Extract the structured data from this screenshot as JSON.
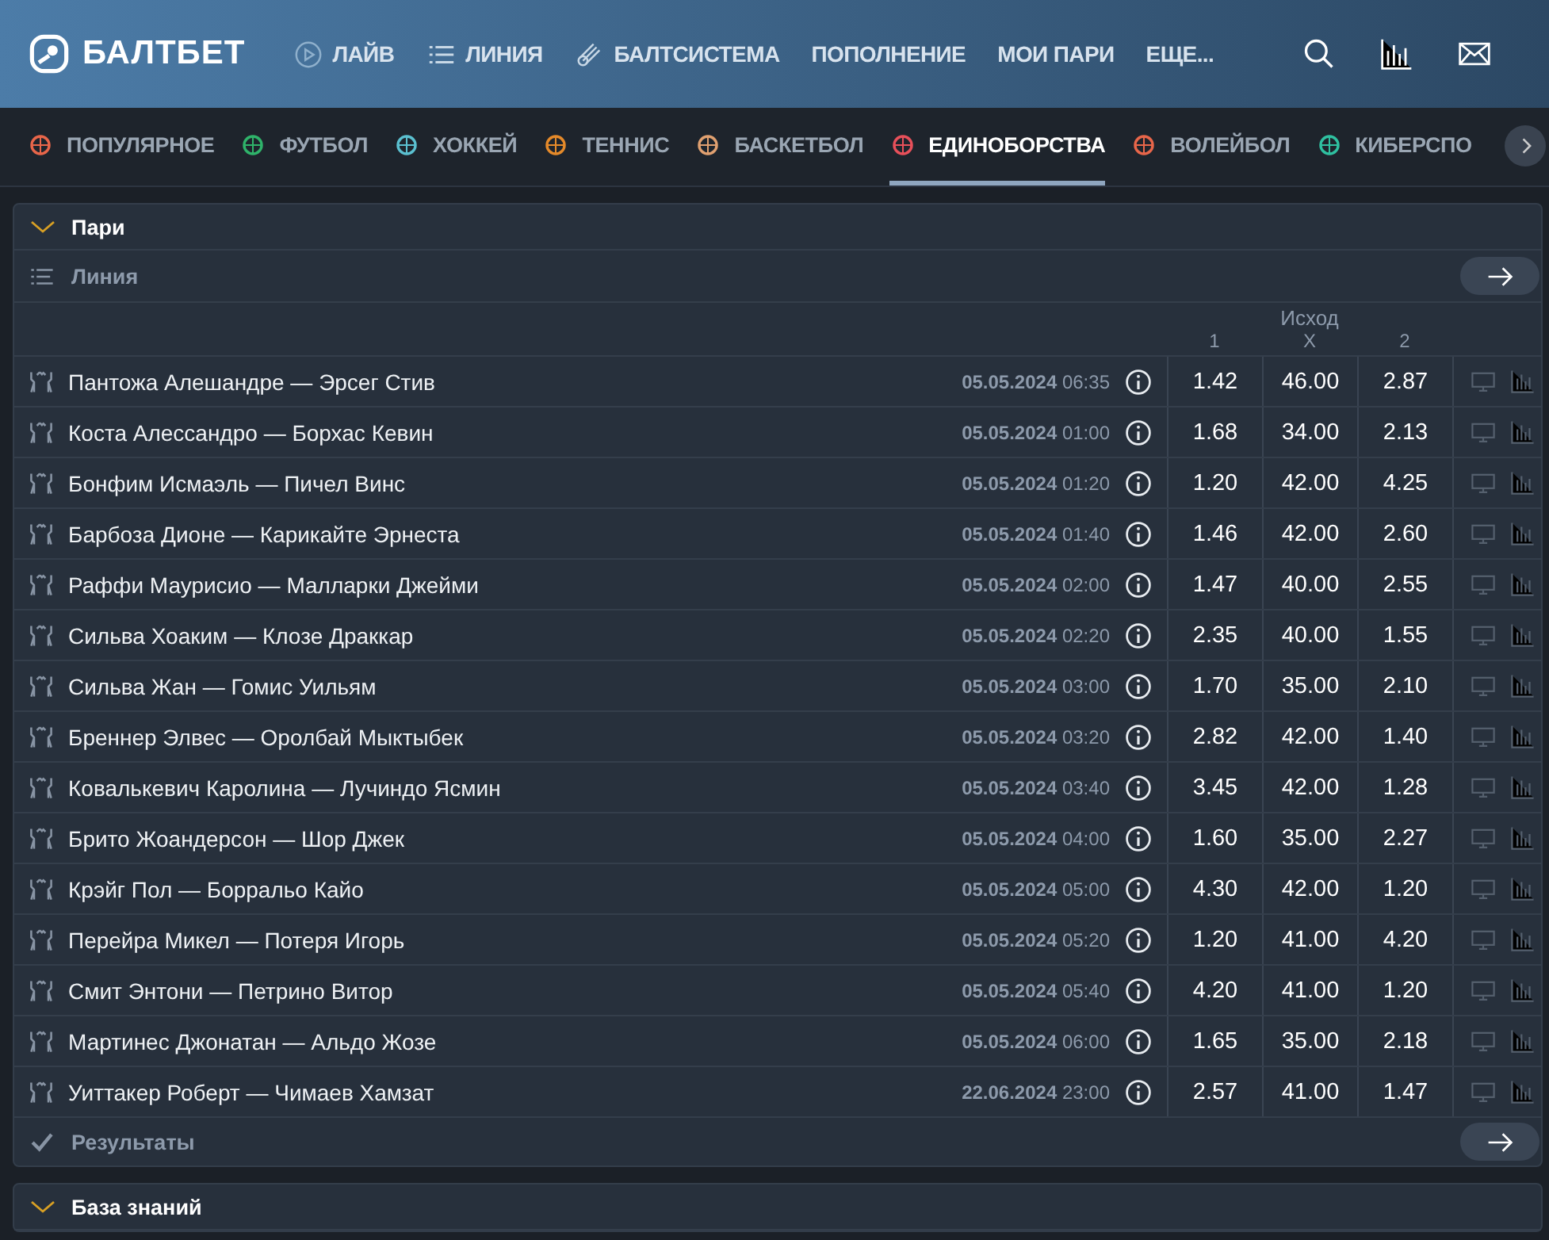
{
  "header": {
    "logo": "БАЛТБЕТ",
    "nav": [
      {
        "label": "ЛАЙВ",
        "kind": "play"
      },
      {
        "label": "ЛИНИЯ",
        "kind": "list"
      },
      {
        "label": "БАЛТСИСТЕМА",
        "kind": "system"
      },
      {
        "label": "ПОПОЛНЕНИЕ",
        "kind": "text"
      },
      {
        "label": "МОИ ПАРИ",
        "kind": "text"
      },
      {
        "label": "ЕЩЕ...",
        "kind": "text"
      }
    ]
  },
  "sports": [
    {
      "label": "ПОПУЛЯРНОЕ",
      "color": "#e8664a",
      "selected": false
    },
    {
      "label": "ФУТБОЛ",
      "color": "#2fb36a",
      "selected": false
    },
    {
      "label": "ХОККЕЙ",
      "color": "#5bc0d0",
      "selected": false
    },
    {
      "label": "ТЕННИС",
      "color": "#e58a2a",
      "selected": false
    },
    {
      "label": "БАСКЕТБОЛ",
      "color": "#e0a070",
      "selected": false
    },
    {
      "label": "ЕДИНОБОРСТВА",
      "color": "#e8505a",
      "selected": true
    },
    {
      "label": "ВОЛЕЙБОЛ",
      "color": "#e8664a",
      "selected": false
    },
    {
      "label": "КИБЕРСПО",
      "color": "#2fc0a0",
      "selected": false
    }
  ],
  "section": {
    "title": "Пари",
    "expanded": true,
    "line_label": "Линия",
    "results_label": "Результаты"
  },
  "table": {
    "group": "Исход",
    "columns": [
      "1",
      "X",
      "2"
    ],
    "rows": [
      {
        "match": "Пантожа Алешандре — Эрсег Стив",
        "date": "05.05.2024",
        "time": "06:35",
        "odds": [
          "1.42",
          "46.00",
          "2.87"
        ]
      },
      {
        "match": "Коста Алессандро — Борхас Кевин",
        "date": "05.05.2024",
        "time": "01:00",
        "odds": [
          "1.68",
          "34.00",
          "2.13"
        ]
      },
      {
        "match": "Бонфим Исмаэль — Пичел Винс",
        "date": "05.05.2024",
        "time": "01:20",
        "odds": [
          "1.20",
          "42.00",
          "4.25"
        ]
      },
      {
        "match": "Барбоза Дионе — Карикайте Эрнеста",
        "date": "05.05.2024",
        "time": "01:40",
        "odds": [
          "1.46",
          "42.00",
          "2.60"
        ]
      },
      {
        "match": "Раффи Маурисио — Малларки Джейми",
        "date": "05.05.2024",
        "time": "02:00",
        "odds": [
          "1.47",
          "40.00",
          "2.55"
        ]
      },
      {
        "match": "Сильва Хоаким — Клозе Драккар",
        "date": "05.05.2024",
        "time": "02:20",
        "odds": [
          "2.35",
          "40.00",
          "1.55"
        ]
      },
      {
        "match": "Сильва Жан — Гомис Уильям",
        "date": "05.05.2024",
        "time": "03:00",
        "odds": [
          "1.70",
          "35.00",
          "2.10"
        ]
      },
      {
        "match": "Бреннер Элвес — Оролбай Мыктыбек",
        "date": "05.05.2024",
        "time": "03:20",
        "odds": [
          "2.82",
          "42.00",
          "1.40"
        ]
      },
      {
        "match": "Ковалькевич Каролина — Лучиндо Ясмин",
        "date": "05.05.2024",
        "time": "03:40",
        "odds": [
          "3.45",
          "42.00",
          "1.28"
        ]
      },
      {
        "match": "Брито Жоандерсон — Шор Джек",
        "date": "05.05.2024",
        "time": "04:00",
        "odds": [
          "1.60",
          "35.00",
          "2.27"
        ]
      },
      {
        "match": "Крэйг Пол — Борральо Кайо",
        "date": "05.05.2024",
        "time": "05:00",
        "odds": [
          "4.30",
          "42.00",
          "1.20"
        ]
      },
      {
        "match": "Перейра Микел — Потеря Игорь",
        "date": "05.05.2024",
        "time": "05:20",
        "odds": [
          "1.20",
          "41.00",
          "4.20"
        ]
      },
      {
        "match": "Смит Энтони — Петрино Витор",
        "date": "05.05.2024",
        "time": "05:40",
        "odds": [
          "4.20",
          "41.00",
          "1.20"
        ]
      },
      {
        "match": "Мартинес Джонатан — Альдо Жозе",
        "date": "05.05.2024",
        "time": "06:00",
        "odds": [
          "1.65",
          "35.00",
          "2.18"
        ]
      },
      {
        "match": "Уиттакер Роберт — Чимаев Хамзат",
        "date": "22.06.2024",
        "time": "23:00",
        "odds": [
          "2.57",
          "41.00",
          "1.47"
        ]
      }
    ]
  },
  "knowledge": {
    "title": "База знаний",
    "expanded": true
  }
}
